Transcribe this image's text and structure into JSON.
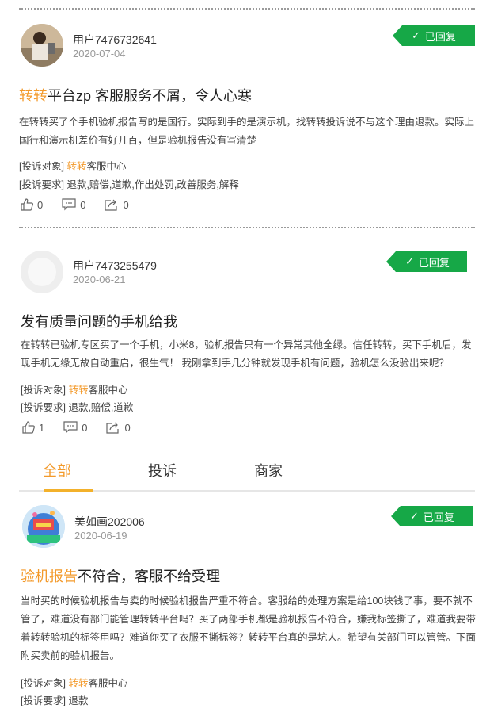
{
  "posts": [
    {
      "user": "用户7476732641",
      "date": "2020-07-04",
      "status": "已回复",
      "title_highlight": "转转",
      "title_rest": "平台zp 客服服务不屑，令人心寒",
      "body": "在转转买了个手机验机报告写的是国行。实际到手的是演示机，找转转投诉说不与这个理由退款。实际上国行和演示机差价有好几百，但是验机报告没有写清楚",
      "target_label": "[投诉对象]",
      "target_highlight": "转转",
      "target_rest": "客服中心",
      "request_label": "[投诉要求]",
      "request_value": "退款,赔偿,道歉,作出处罚,改善服务,解释",
      "likes": "0",
      "comments": "0",
      "shares": "0"
    },
    {
      "user": "用户7473255479",
      "date": "2020-06-21",
      "status": "已回复",
      "title_highlight": "",
      "title_rest": "发有质量问题的手机给我",
      "body": "在转转已验机专区买了一个手机，小米8，验机报告只有一个异常其他全绿。信任转转，买下手机后，发现手机无缘无故自动重启，很生气！ 我刚拿到手几分钟就发现手机有问题，验机怎么没验出来呢？",
      "target_label": "[投诉对象]",
      "target_highlight": "转转",
      "target_rest": "客服中心",
      "request_label": "[投诉要求]",
      "request_value": "退款,赔偿,道歉",
      "likes": "1",
      "comments": "0",
      "shares": "0"
    },
    {
      "user": "美如画202006",
      "date": "2020-06-19",
      "status": "已回复",
      "title_highlight": "验机报告",
      "title_rest": "不符合，客服不给受理",
      "body": "当时买的时候验机报告与卖的时候验机报告严重不符合。客服给的处理方案是给100块钱了事，要不就不管了，难道没有部门能管理转转平台吗？买了两部手机都是验机报告不符合，嫌我标签撕了，难道我要带着转转验机的标签用吗？难道你买了衣服不撕标签？转转平台真的是坑人。希望有关部门可以管管。下面附买卖前的验机报告。",
      "target_label": "[投诉对象]",
      "target_highlight": "转转",
      "target_rest": "客服中心",
      "request_label": "[投诉要求]",
      "request_value": "退款"
    }
  ],
  "tabs": [
    "全部",
    "投诉",
    "商家"
  ],
  "colors": {
    "accent_orange": "#f39a2b",
    "status_green": "#16a847",
    "tab_indicator": "#f3b12b"
  },
  "icons": [
    "thumbs-up-icon",
    "comment-icon",
    "share-icon",
    "check-icon"
  ]
}
